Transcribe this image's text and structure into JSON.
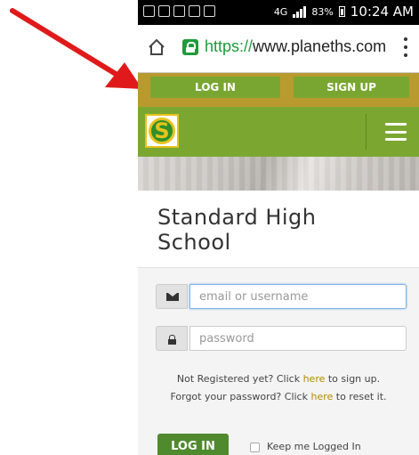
{
  "status_bar": {
    "network": "4G",
    "battery": "83%",
    "time": "10:24 AM"
  },
  "browser": {
    "url_scheme": "https://",
    "url_host": "www.planeths.com"
  },
  "auth_bar": {
    "login_label": "LOG IN",
    "signup_label": "SIGN UP"
  },
  "header": {
    "logo_letter": "S"
  },
  "school": {
    "name_line1": "Standard High",
    "name_line2": "School"
  },
  "login_form": {
    "email_placeholder": "email or username",
    "password_placeholder": "password",
    "register_prefix": "Not Registered yet? Click ",
    "register_link": "here",
    "register_suffix": " to sign up.",
    "forgot_prefix": "Forgot your password? Click ",
    "forgot_link": "here",
    "forgot_suffix": " to reset it.",
    "login_button": "LOG IN",
    "keep_logged_in": "Keep me Logged In"
  },
  "colors": {
    "accent_green": "#7ba730",
    "gold": "#b99a2e",
    "arrow_red": "#e01a1a",
    "secure_green": "#1e9b3b"
  }
}
